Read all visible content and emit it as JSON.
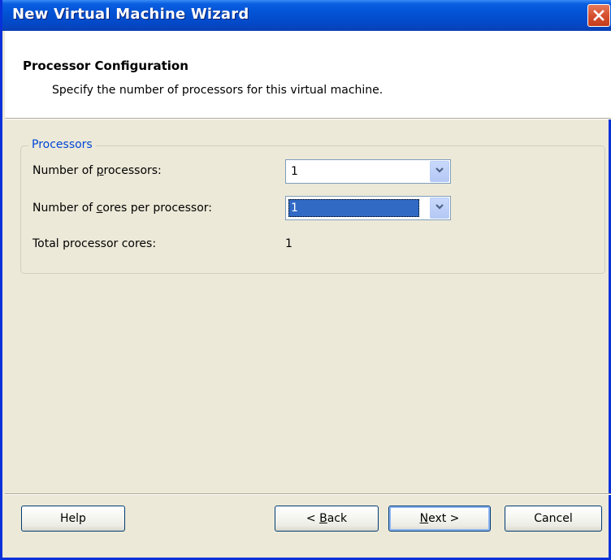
{
  "window": {
    "title": "New Virtual Machine Wizard"
  },
  "header": {
    "title": "Processor Configuration",
    "subtitle": "Specify the number of processors for this virtual machine."
  },
  "group": {
    "legend": "Processors",
    "processors_label_pre": "Number of ",
    "processors_label_key": "p",
    "processors_label_post": "rocessors:",
    "processors_value": "1",
    "cores_label_pre": "Number of ",
    "cores_label_key": "c",
    "cores_label_post": "ores per processor:",
    "cores_value": "1",
    "total_label": "Total processor cores:",
    "total_value": "1"
  },
  "buttons": {
    "help": "Help",
    "back_pre": "< ",
    "back_key": "B",
    "back_post": "ack",
    "next_key": "N",
    "next_post": "ext >",
    "cancel": "Cancel"
  },
  "colors": {
    "titlebar": "#0353d6",
    "dialog_bg": "#ece9d8",
    "legend": "#0046d5",
    "selection": "#316ac5",
    "close_button": "#d6512f"
  },
  "icons": {
    "close": "close-icon",
    "dropdown": "chevron-down-icon"
  }
}
